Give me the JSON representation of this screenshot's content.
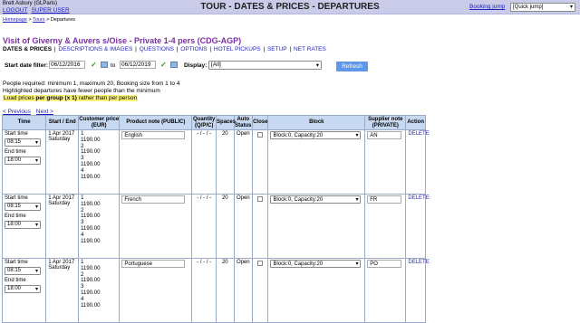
{
  "topbar": {
    "user_name": "Brett Asbury (GLParis)",
    "logout": "LOGOUT",
    "super_user": "SUPER USER",
    "title": "TOUR - DATES & PRICES - DEPARTURES",
    "booking_jump": "Booking jump",
    "quick_jump": "[Quick jump]"
  },
  "breadcrumb": {
    "homepage": "Homepage",
    "sep1": " > ",
    "tours": "Tours",
    "sep2": " > ",
    "current": "Departures"
  },
  "page_title": "Visit of Giverny & Auvers s/Oise - Private 1-4 pers (CDG-AGP)",
  "subnav": {
    "items": [
      "DATES & PRICES",
      "DESCRIPTIONS & IMAGES",
      "QUESTIONS",
      "OPTIONS",
      "HOTEL PICKUPS",
      "SETUP",
      "NET RATES"
    ],
    "sep": " | "
  },
  "filter": {
    "label": "Start date filter:",
    "from": "06/12/2016",
    "to_label": "to",
    "to": "06/12/2019",
    "display_label": "Display:",
    "display_value": "[All]",
    "refresh": "Refresh"
  },
  "info": {
    "line1": "People required: minimum 1, maximum 20, Booking size from 1 to 4",
    "line2": "Highlighted departures have fewer people than the minimum",
    "line3a": "Load prices ",
    "line3b": "per group (x 1)",
    "line3c": " rather than per person"
  },
  "pager": {
    "prev": "< Previous",
    "next": "Next >"
  },
  "table": {
    "headers": {
      "time": "Time",
      "start_end": "Start / End",
      "price": "Customer price (EUR)",
      "note": "Product note (PUBLIC)",
      "qty": "Quantity (Q/P/C)",
      "spaces": "Spaces",
      "auto": "Auto Status",
      "close": "Close",
      "block": "Block",
      "supplier": "Supplier note (PRIVATE)",
      "action": "Action"
    },
    "rows": [
      {
        "start_label": "Start time",
        "start_time": "08:15",
        "end_label": "End time",
        "end_time": "18:00",
        "date": "1 Apr 2017",
        "day": "Saturday",
        "prices": [
          "1",
          "1190.00",
          "2",
          "1190.00",
          "3",
          "1190.00",
          "4",
          "1190.00"
        ],
        "note": "English",
        "qty": "- / - / -",
        "spaces": "20",
        "status": "Open",
        "block": "Block:0, Capacity:20",
        "supplier": "AN",
        "action": "DELETE"
      },
      {
        "start_label": "Start time",
        "start_time": "08:15",
        "end_label": "End time",
        "end_time": "18:00",
        "date": "1 Apr 2017",
        "day": "Saturday",
        "prices": [
          "1",
          "1190.00",
          "2",
          "1190.00",
          "3",
          "1190.00",
          "4",
          "1190.00"
        ],
        "note": "French",
        "qty": "- / - / -",
        "spaces": "20",
        "status": "Open",
        "block": "Block:0, Capacity:20",
        "supplier": "FR",
        "action": "DELETE"
      },
      {
        "start_label": "Start time",
        "start_time": "08:15",
        "end_label": "End time",
        "end_time": "18:00",
        "date": "1 Apr 2017",
        "day": "Saturday",
        "prices": [
          "1",
          "1190.00",
          "2",
          "1190.00",
          "3",
          "1190.00",
          "4",
          "1190.00"
        ],
        "note": "Portuguese",
        "qty": "- / - / -",
        "spaces": "20",
        "status": "Open",
        "block": "Block:0, Capacity:20",
        "supplier": "PO",
        "action": "DELETE"
      }
    ]
  },
  "colors": {
    "topbar": "#c9cbe9",
    "title": "#7a2fa0",
    "link": "#1f1fbd",
    "header": "#c7d9f0",
    "refresh": "#5f98ea",
    "highlight": "#fbf27b"
  }
}
